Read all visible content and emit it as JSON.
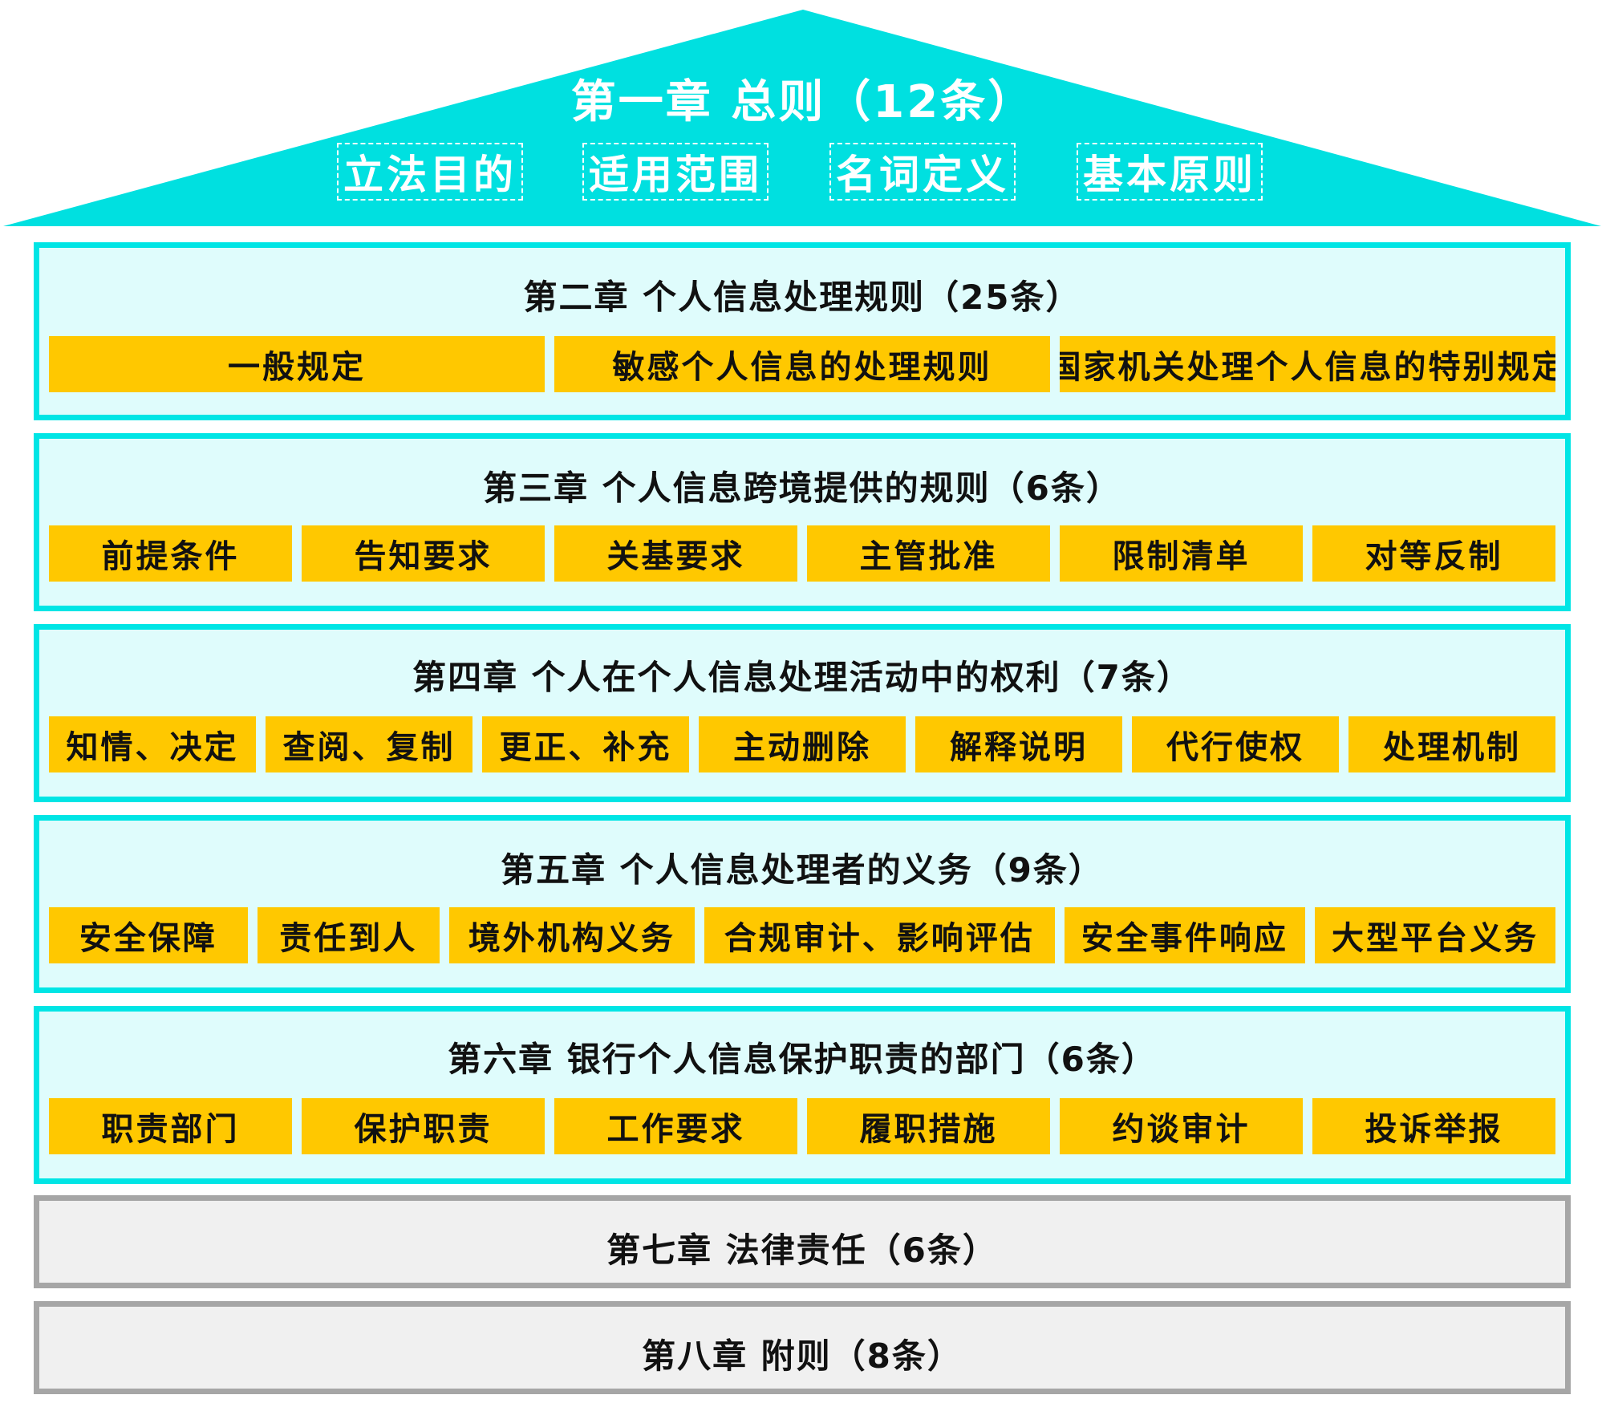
{
  "colors": {
    "roof": "#00e0e0",
    "chapter_fill": "#dffcfc",
    "chapter_border": "#00e5e5",
    "item_fill": "#ffc800",
    "gray_fill": "#f0f0f0",
    "gray_border": "#a6a6a6"
  },
  "roof": {
    "title": "第一章 总则（12条）",
    "items": [
      "立法目的",
      "适用范围",
      "名词定义",
      "基本原则"
    ]
  },
  "chapters": [
    {
      "title": "第二章 个人信息处理规则（25条）",
      "items": [
        "一般规定",
        "敏感个人信息的处理规则",
        "国家机关处理个人信息的特别规定"
      ]
    },
    {
      "title": "第三章 个人信息跨境提供的规则（6条）",
      "items": [
        "前提条件",
        "告知要求",
        "关基要求",
        "主管批准",
        "限制清单",
        "对等反制"
      ]
    },
    {
      "title": "第四章 个人在个人信息处理活动中的权利（7条）",
      "items": [
        "知情、决定",
        "查阅、复制",
        "更正、补充",
        "主动删除",
        "解释说明",
        "代行使权",
        "处理机制"
      ]
    },
    {
      "title": "第五章 个人信息处理者的义务（9条）",
      "items": [
        "安全保障",
        "责任到人",
        "境外机构义务",
        "合规审计、影响评估",
        "安全事件响应",
        "大型平台义务"
      ]
    },
    {
      "title": "第六章 银行个人信息保护职责的部门（6条）",
      "items": [
        "职责部门",
        "保护职责",
        "工作要求",
        "履职措施",
        "约谈审计",
        "投诉举报"
      ]
    },
    {
      "title": "第七章 法律责任（6条）"
    },
    {
      "title": "第八章 附则（8条）"
    }
  ]
}
